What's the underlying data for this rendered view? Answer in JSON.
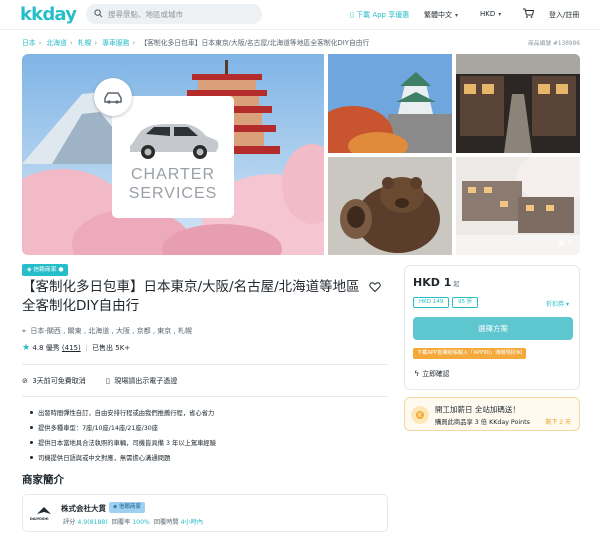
{
  "header": {
    "logo": "kkday",
    "search_placeholder": "搜尋景點、地區或城市",
    "app_download": "下載 App 享優惠",
    "language": "繁體中文",
    "currency": "HKD",
    "login": "登入/註冊"
  },
  "breadcrumb": {
    "items": [
      "日本",
      "北海道",
      "札幌",
      "專車服務"
    ],
    "current": "【客制化多日包車】日本東京/大阪/名古屋/北海道等地區全客制化DIY自由行",
    "product_no": "商品編號 #138986"
  },
  "gallery": {
    "main_card_line1": "CHARTER",
    "main_card_line2": "SERVICES",
    "photo_count": "6"
  },
  "product": {
    "badge": "信賴商家",
    "title": "【客制化多日包車】日本東京/大阪/名古屋/北海道等地區全客制化DIY自由行",
    "location": "日本-關西 , 關東 , 北海道 , 大阪 , 京都 , 東京 , 札幌",
    "rating": "4.8",
    "rating_label": "優秀",
    "review_count": "(415)",
    "sold": "已售出 5K+",
    "features": [
      "3天前可免費取消",
      "現場請出示電子憑證"
    ],
    "bullets": [
      "出發時間彈性自訂，自由安排行程或由我們推薦行程，省心省力",
      "提供多種車型：7座/10座/14座/21座/30座",
      "提供日本當地具合法執照的車輛，司機皆具備 3 年以上駕車經驗",
      "司機提供日語與或中文對應，無需擔心溝通問題"
    ]
  },
  "merchant": {
    "heading": "商家簡介",
    "name": "株式会社大貫",
    "badge": "信賴商家",
    "logo_text": "DAIYOSHI",
    "score_label": "評分",
    "score": "4.9(8188)",
    "reply_rate_label": "回覆率",
    "reply_rate": "100%",
    "reply_time_label": "回覆時間",
    "reply_time": "4小時內"
  },
  "booking": {
    "price_currency": "HKD",
    "price_value": "1",
    "price_suffix": "起",
    "chip_price": "HKD 149",
    "chip_discount": "95 折",
    "coupon": "折扣券",
    "book_button": "選擇方案",
    "app_promo": "下載APP首購結帳輸入「APP90」滿額現折90",
    "instant_confirm": "立即確認"
  },
  "promo": {
    "title": "開工加薪日 全站加碼送！",
    "detail": "購買此商品享 3 倍 KKday Points",
    "countdown": "剩下 2 天"
  },
  "colors": {
    "brand": "#26bec9",
    "button": "#5ec6cf",
    "promo": "#f4a93a"
  }
}
